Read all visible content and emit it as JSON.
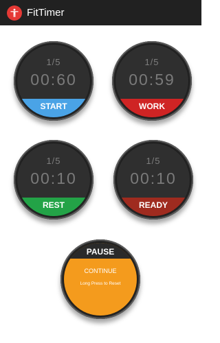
{
  "app": {
    "title": "FitTimer"
  },
  "watches": [
    {
      "round": "1/5",
      "time": "00:60",
      "label": "START",
      "color": "#4aa3e6"
    },
    {
      "round": "1/5",
      "time": "00:59",
      "label": "WORK",
      "color": "#cf2424"
    },
    {
      "round": "1/5",
      "time": "00:10",
      "label": "REST",
      "color": "#23a347"
    },
    {
      "round": "1/5",
      "time": "00:10",
      "label": "READY",
      "color": "#9f2b1f"
    }
  ],
  "pause": {
    "title": "PAUSE",
    "continue_label": "CONTINUE",
    "hint": "Long Press to Reset",
    "color": "#f49b1d"
  }
}
